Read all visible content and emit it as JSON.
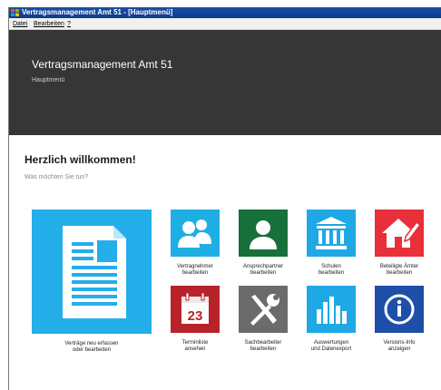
{
  "window": {
    "title": "Vertragsmanagement Amt 51 - [Hauptmenü]"
  },
  "menu": {
    "items": [
      "Datei",
      "Bearbeiten",
      "?"
    ]
  },
  "header": {
    "title": "Vertragsmanagement Amt 51",
    "subtitle": "Hauptmenü"
  },
  "main": {
    "welcome": "Herzlich willkommen!",
    "question": "Was möchten Sie tun?",
    "big_tile": {
      "label_line1": "Verträge neu erfassen",
      "label_line2": "oder bearbeiten",
      "icon": "document-icon",
      "color": "#24aeea"
    },
    "tiles": [
      {
        "line1": "Vertragnehmer",
        "line2": "bearbeiten",
        "icon": "people-icon",
        "color": "#1faee3"
      },
      {
        "line1": "Ansprechpartner",
        "line2": "bearbeiten",
        "icon": "person-icon",
        "color": "#17703a"
      },
      {
        "line1": "Schulen",
        "line2": "bearbeiten",
        "icon": "building-icon",
        "color": "#1ea8e6"
      },
      {
        "line1": "Beteiligte Ämter",
        "line2": "bearbeiten",
        "icon": "house-edit-icon",
        "color": "#e82f3a"
      },
      {
        "line1": "Terminliste",
        "line2": "ansehen",
        "icon": "calendar-icon",
        "color": "#b8232b"
      },
      {
        "line1": "Sachbearbeiter",
        "line2": "bearbeiten",
        "icon": "tools-icon",
        "color": "#6b6b6b"
      },
      {
        "line1": "Auswertungen",
        "line2": "und Datenexport",
        "icon": "bar-chart-icon",
        "color": "#1ea8e6"
      },
      {
        "line1": "Versions-Info",
        "line2": "anzeigen",
        "icon": "info-icon",
        "color": "#1e4fa8"
      }
    ],
    "calendar_day": "23"
  }
}
